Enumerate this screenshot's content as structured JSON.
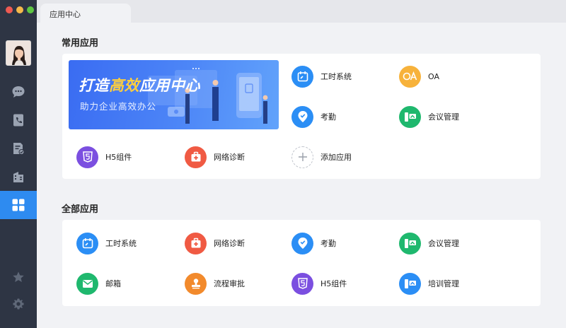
{
  "window": {
    "tab_title": "应用中心"
  },
  "sidebar": {
    "nav": [
      {
        "name": "chat",
        "icon": "chat-bubble-icon"
      },
      {
        "name": "contacts",
        "icon": "phone-book-icon"
      },
      {
        "name": "documents",
        "icon": "document-edit-icon"
      },
      {
        "name": "organization",
        "icon": "building-icon"
      },
      {
        "name": "apps",
        "icon": "app-grid-icon",
        "active": true
      },
      {
        "name": "favorites",
        "icon": "star-icon"
      },
      {
        "name": "settings",
        "icon": "gear-icon"
      }
    ]
  },
  "common": {
    "title": "常用应用",
    "banner": {
      "title_a": "打造",
      "title_highlight": "高效",
      "title_b": "应用中心",
      "subtitle": "助力企业高效办公"
    },
    "apps": [
      {
        "label": "工时系统",
        "icon": "calendar-icon",
        "color": "#2b8ef5"
      },
      {
        "label": "OA",
        "icon": "oa-icon",
        "color": "#f7b23b"
      },
      {
        "label": "考勤",
        "icon": "location-check-icon",
        "color": "#2b8ef5"
      },
      {
        "label": "会议管理",
        "icon": "meeting-icon",
        "color": "#1fb86e"
      },
      {
        "label": "H5组件",
        "icon": "html5-icon",
        "color": "#7b4fe0"
      },
      {
        "label": "网络诊断",
        "icon": "medical-kit-icon",
        "color": "#f05a43"
      },
      {
        "label": "添加应用",
        "icon": "plus-icon",
        "color": "#ffffff"
      }
    ]
  },
  "all": {
    "title": "全部应用",
    "apps": [
      {
        "label": "工时系统",
        "icon": "calendar-icon",
        "color": "#2b8ef5"
      },
      {
        "label": "网络诊断",
        "icon": "medical-kit-icon",
        "color": "#f05a43"
      },
      {
        "label": "考勤",
        "icon": "location-check-icon",
        "color": "#2b8ef5"
      },
      {
        "label": "会议管理",
        "icon": "meeting-icon",
        "color": "#1fb86e"
      },
      {
        "label": "邮箱",
        "icon": "mail-icon",
        "color": "#1fb86e"
      },
      {
        "label": "流程审批",
        "icon": "stamp-icon",
        "color": "#f28a2c"
      },
      {
        "label": "H5组件",
        "icon": "html5-icon",
        "color": "#7b4fe0"
      },
      {
        "label": "培训管理",
        "icon": "training-icon",
        "color": "#2b8ef5"
      }
    ]
  }
}
